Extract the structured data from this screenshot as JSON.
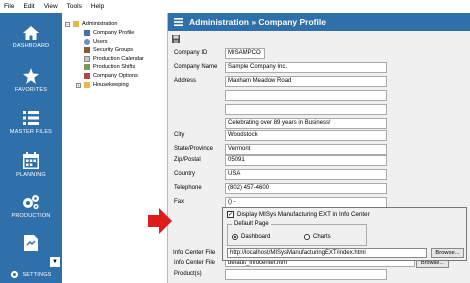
{
  "menu": [
    "File",
    "Edit",
    "View",
    "Tools",
    "Help"
  ],
  "sidebar": {
    "items": [
      {
        "label": "DASHBOARD",
        "icon": "home-icon"
      },
      {
        "label": "FAVORITES",
        "icon": "star-icon"
      },
      {
        "label": "MASTER FILES",
        "icon": "list-icon"
      },
      {
        "label": "PLANNING",
        "icon": "calendar-icon"
      },
      {
        "label": "PRODUCTION",
        "icon": "gears-icon"
      },
      {
        "label": "SETTINGS",
        "icon": "gear-icon"
      }
    ],
    "collapse_label": "▼"
  },
  "tree": {
    "root": "Administration",
    "children": [
      "Company Profile",
      "Users",
      "Security Groups",
      "Production Calendar",
      "Production Shifts",
      "Company Options"
    ],
    "housekeeping": "Housekeeping"
  },
  "header": {
    "title": "Administration » Company Profile"
  },
  "form": {
    "company_id": {
      "label": "Company ID",
      "value": "MISAMPCO"
    },
    "company_name": {
      "label": "Company Name",
      "value": "Sample Company Inc."
    },
    "address": {
      "label": "Address",
      "lines": [
        "Maxham Meadow Road",
        "",
        "",
        "Celebrating over 89 years in Business!"
      ]
    },
    "city": {
      "label": "City",
      "value": "Woodstock"
    },
    "state": {
      "label": "State/Province",
      "value": "Vermont"
    },
    "zip": {
      "label": "Zip/Postal",
      "value": "05091"
    },
    "country": {
      "label": "Country",
      "value": "USA"
    },
    "telephone": {
      "label": "Telephone",
      "value": "(802) 457-4600"
    },
    "fax": {
      "label": "Fax",
      "value": "() -"
    },
    "info_center_file": {
      "label": "Info Center File",
      "value": "default_infocenter.htm"
    },
    "products": {
      "label": "Product(s)"
    }
  },
  "popup": {
    "checkbox_label": "Display MISys Manufacturing EXT in Info Center",
    "checkbox_checked": true,
    "default_page_title": "Default Page",
    "options": [
      "Dashboard",
      "Charts"
    ],
    "selected": "Dashboard",
    "info_center_label": "Info Center File",
    "info_center_url": "http://localhost/MISysManufacturingEXT/index.html",
    "browse_label": "Browse..."
  },
  "colors": {
    "accent": "#2f6faa",
    "arrow": "#e01b1b"
  }
}
